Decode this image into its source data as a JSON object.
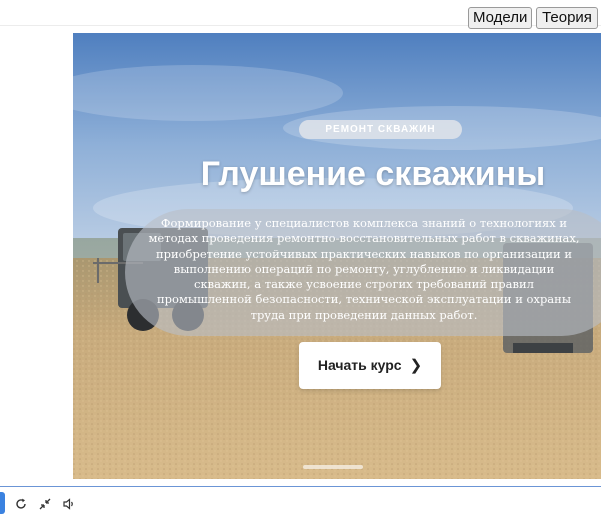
{
  "topbar": {
    "buttons": [
      {
        "label": "Модели"
      },
      {
        "label": "Теория"
      }
    ]
  },
  "hero": {
    "badge": "РЕМОНТ СКВАЖИН",
    "title": "Глушение скважины",
    "description": "Формирование у специалистов комплекса знаний о технологиях и методах проведения ремонтно-восстановительных работ в скважинах, приобретение устойчивых практических навыков по организации и выполнению операций по ремонту, углублению и ликвидации скважин, а также усвоение строгих требований правил промышленной безопасности, технической эксплуатации и охраны труда при проведении данных работ.",
    "start_button": "Начать курс",
    "start_chevron": "❯"
  },
  "controls": {
    "icons": [
      "reload-icon",
      "collapse-icon",
      "volume-icon"
    ]
  },
  "colors": {
    "accent": "#3b82e0",
    "sky_top": "#5b86c4",
    "sand": "#c9ae83"
  }
}
